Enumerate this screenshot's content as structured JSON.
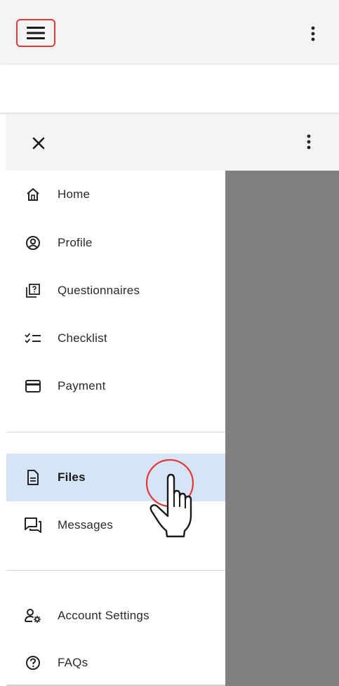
{
  "top_bar": {
    "menu_icon": "hamburger-menu-icon",
    "more_icon": "more-vert-icon"
  },
  "drawer_header": {
    "close_icon": "close-icon",
    "more_icon": "more-vert-icon"
  },
  "nav": {
    "items": [
      {
        "label": "Home",
        "icon": "home-icon"
      },
      {
        "label": "Profile",
        "icon": "profile-icon"
      },
      {
        "label": "Questionnaires",
        "icon": "questionnaire-icon"
      },
      {
        "label": "Checklist",
        "icon": "checklist-icon"
      },
      {
        "label": "Payment",
        "icon": "credit-card-icon"
      },
      {
        "label": "Files",
        "icon": "file-icon",
        "active": true
      },
      {
        "label": "Messages",
        "icon": "messages-icon"
      },
      {
        "label": "Account Settings",
        "icon": "account-settings-icon"
      },
      {
        "label": "FAQs",
        "icon": "help-icon"
      }
    ]
  },
  "colors": {
    "active_bg": "#d6e4f7",
    "highlight_border": "#e53935",
    "overlay": "#808081",
    "topbar_bg": "#f4f4f6"
  }
}
